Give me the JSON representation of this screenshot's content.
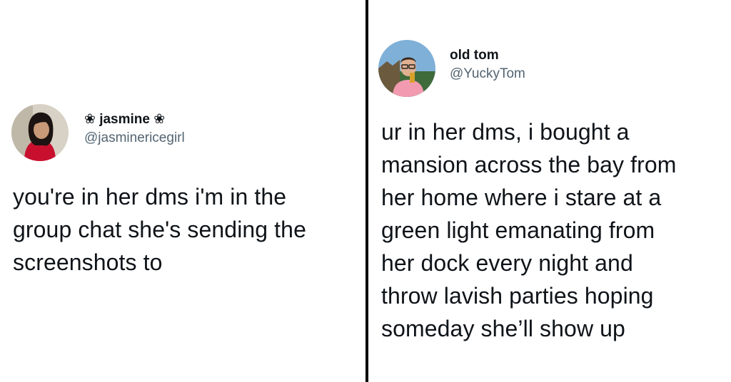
{
  "left_tweet": {
    "display_name": "❀ jasmine ❀",
    "handle": "@jasminericegirl",
    "text": "you're in her dms i'm in the\ngroup chat she's sending the\nscreenshots to",
    "avatar_icon": "profile-photo-woman"
  },
  "right_tweet": {
    "display_name": "old tom",
    "handle": "@YuckyTom",
    "text": "ur in her dms, i bought a\nmansion across the bay from\nher home where i stare at a\ngreen light emanating from\nher dock every night and\nthrow lavish parties hoping\nsomeday she’ll show up",
    "avatar_icon": "profile-photo-man"
  },
  "colors": {
    "text": "#0f1419",
    "handle": "#536471",
    "divider": "#000000"
  }
}
